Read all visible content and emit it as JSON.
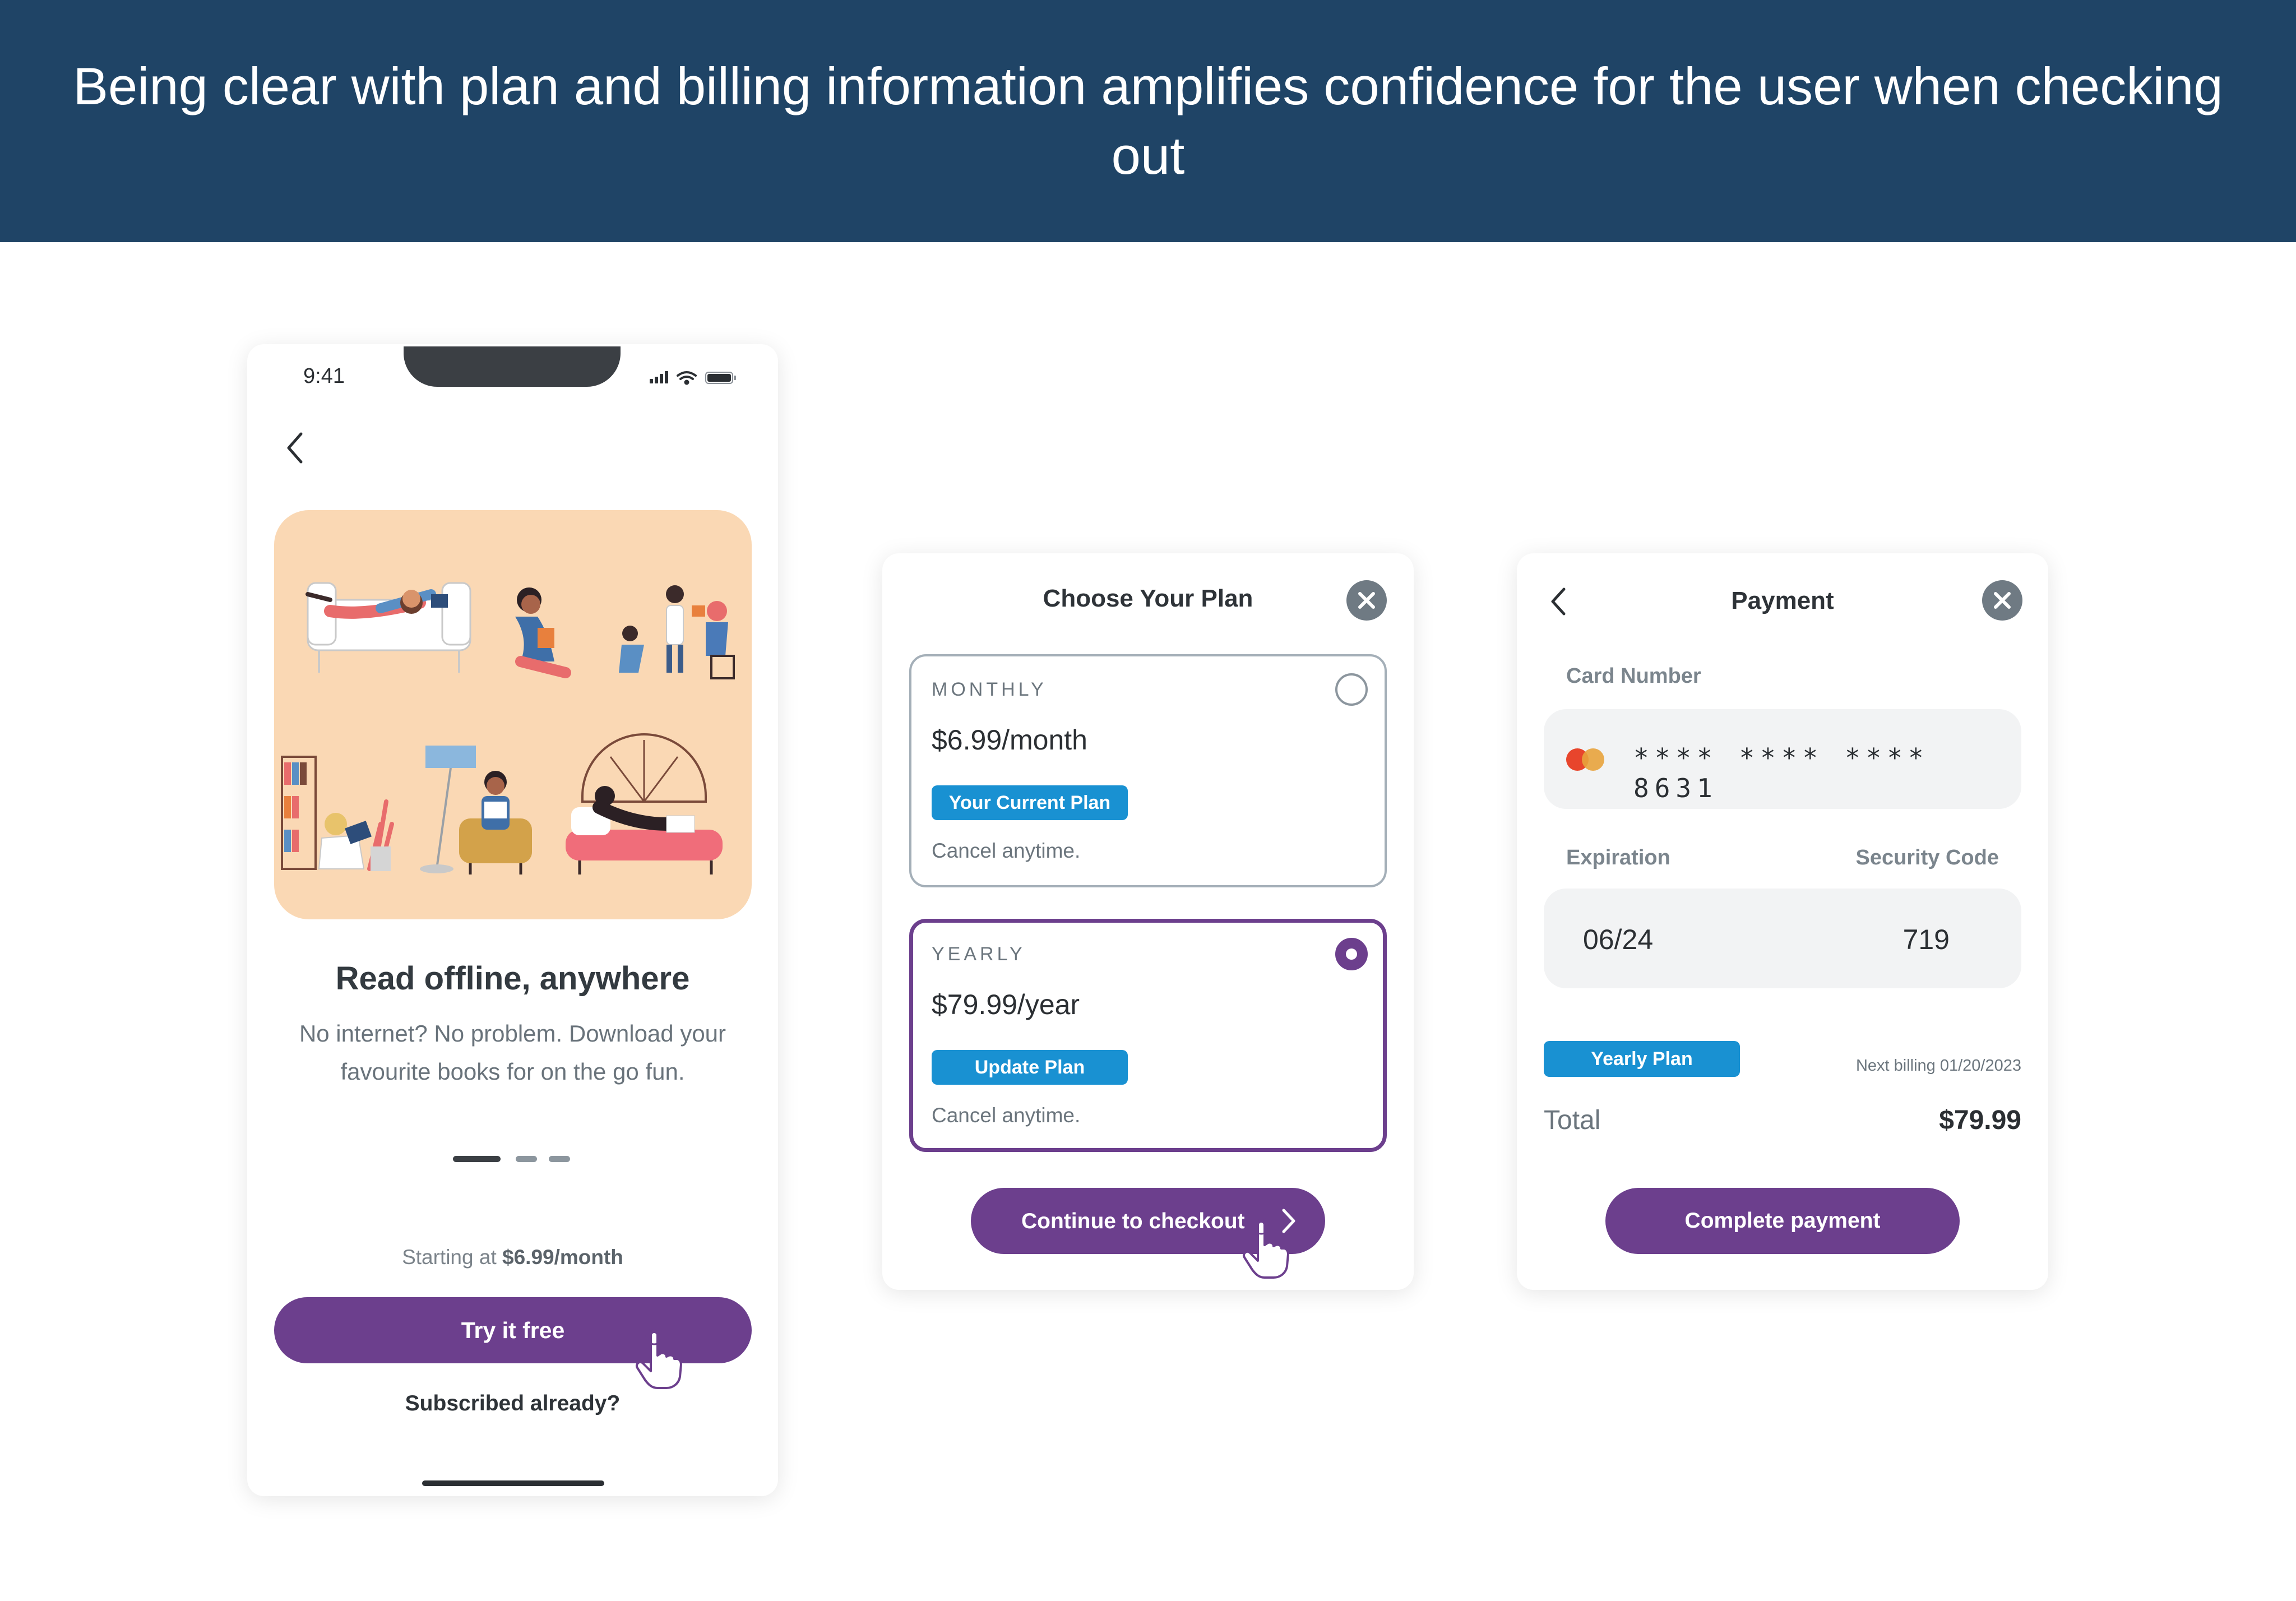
{
  "banner": {
    "text": "Being clear with plan and billing information amplifies confidence for the user when checking out"
  },
  "phone": {
    "status_time": "9:41",
    "title": "Read offline, anywhere",
    "description": "No internet? No problem. Download your favourite books for on the go fun.",
    "pager": {
      "count": 3,
      "active_index": 0
    },
    "starting_prefix": "Starting at ",
    "starting_price": "$6.99/month",
    "try_button": "Try it free",
    "subscribed_link": "Subscribed already?"
  },
  "plan_card": {
    "title": "Choose Your Plan",
    "plans": [
      {
        "period": "MONTHLY",
        "price": "$6.99/month",
        "badge": "Your Current Plan",
        "note": "Cancel anytime.",
        "selected": false
      },
      {
        "period": "YEARLY",
        "price": "$79.99/year",
        "badge": "Update Plan",
        "note": "Cancel anytime.",
        "selected": true
      }
    ],
    "checkout_button": "Continue to checkout"
  },
  "payment_card": {
    "title": "Payment",
    "card_number_label": "Card Number",
    "card_number_masked": "**** **** **** 8631",
    "expiration_label": "Expiration",
    "security_code_label": "Security Code",
    "expiration_value": "06/24",
    "security_code_value": "719",
    "plan_badge": "Yearly Plan",
    "next_billing": "Next billing 01/20/2023",
    "total_label": "Total",
    "total_value": "$79.99",
    "complete_button": "Complete payment"
  },
  "icons": {
    "back": "chevron-left-icon",
    "close": "close-icon",
    "pointer": "hand-pointer-icon",
    "card_brand": "mastercard-icon"
  },
  "colors": {
    "banner_bg": "#1f4466",
    "accent_purple": "#6c3f8d",
    "badge_blue": "#1991d2",
    "hero_bg": "#fad8b4"
  }
}
